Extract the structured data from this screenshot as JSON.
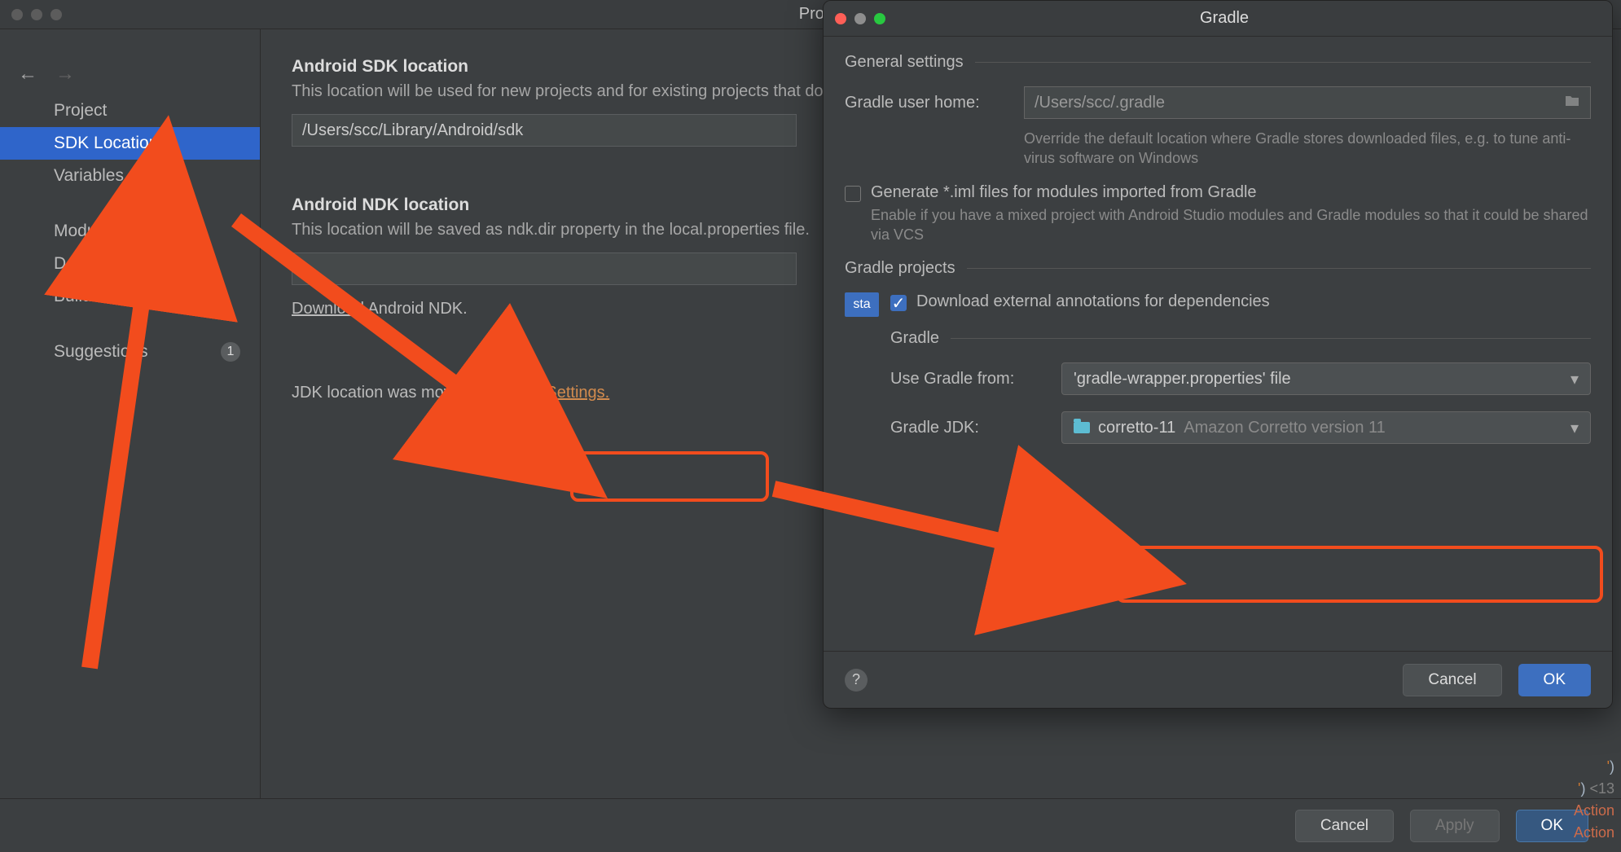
{
  "back": {
    "title": "Project Stru",
    "sidebar": {
      "items": [
        {
          "label": "Project"
        },
        {
          "label": "SDK Location"
        },
        {
          "label": "Variables"
        },
        {
          "label": "Modules"
        },
        {
          "label": "Dependencies"
        },
        {
          "label": "Build Variants"
        },
        {
          "label": "Suggestions",
          "badge": "1"
        }
      ]
    },
    "sdk": {
      "title": "Android SDK location",
      "desc": "This location will be used for new projects and for existing projects that do not have a local.properties file with a sdk.dir property.",
      "path": "/Users/scc/Library/Android/sdk"
    },
    "ndk": {
      "title": "Android NDK location",
      "desc": "This location will be saved as ndk.dir property in the local.properties file.",
      "download_link": "Download",
      "download_rest": "Android NDK."
    },
    "jdk": {
      "prefix": "JDK location was moved to",
      "link": "Gradle Settings."
    },
    "footer": {
      "cancel": "Cancel",
      "apply": "Apply",
      "ok": "OK"
    }
  },
  "front": {
    "title": "Gradle",
    "general": {
      "header": "General settings",
      "user_home_label": "Gradle user home:",
      "user_home_value": "/Users/scc/.gradle",
      "user_home_help": "Override the default location where Gradle stores downloaded files, e.g. to tune anti-virus software on Windows",
      "iml_label": "Generate *.iml files for modules imported from Gradle",
      "iml_help": "Enable if you have a mixed project with Android Studio modules and Gradle modules so that it could be shared via VCS"
    },
    "projects": {
      "header": "Gradle projects",
      "pill": "sta",
      "dl_annotations": "Download external annotations for dependencies",
      "gradle_header": "Gradle",
      "use_from_label": "Use Gradle from:",
      "use_from_value": "'gradle-wrapper.properties' file",
      "jdk_label": "Gradle JDK:",
      "jdk_value": "corretto-11",
      "jdk_suffix": "Amazon Corretto version 11"
    },
    "footer": {
      "cancel": "Cancel",
      "ok": "OK"
    }
  },
  "editor_artifacts": {
    "l1a": "'",
    "l1b": ")",
    "l2a": "'",
    "l2b": ")",
    "l2c": " <13",
    "l3": "Action",
    "l4": "Action"
  }
}
